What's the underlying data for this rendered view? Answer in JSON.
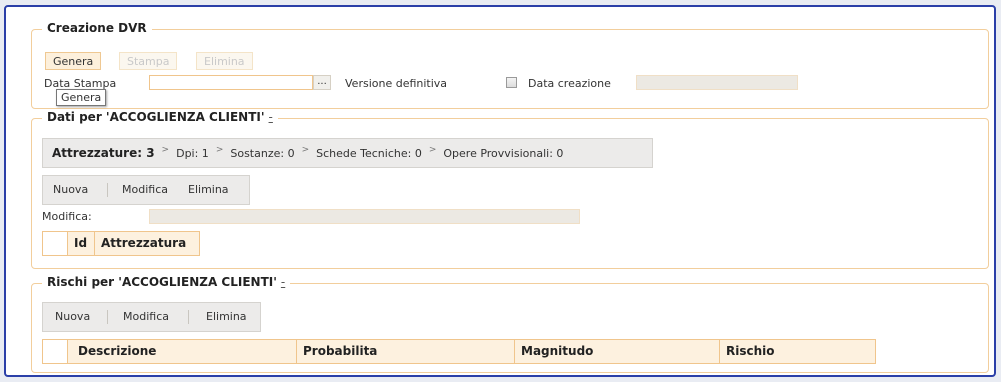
{
  "creazione": {
    "legend": "Creazione DVR",
    "buttons": {
      "genera": "Genera",
      "stampa": "Stampa",
      "elimina": "Elimina"
    },
    "data_stampa_label": "Data Stampa",
    "data_stampa_value": "",
    "ellipsis": "...",
    "versione_label": "Versione definitiva",
    "versione_checked": false,
    "data_creazione_label": "Data creazione",
    "data_creazione_value": "",
    "tooltip": "Genera"
  },
  "dati": {
    "legend": "Dati per 'ACCOGLIENZA CLIENTI'",
    "collapse": "-",
    "tabs": [
      {
        "label": "Attrezzature: 3",
        "selected": true
      },
      {
        "label": "Dpi: 1"
      },
      {
        "label": "Sostanze: 0"
      },
      {
        "label": "Schede Tecniche: 0"
      },
      {
        "label": "Opere Provvisionali: 0"
      }
    ],
    "tab_separator": ">",
    "toolbar": {
      "nuova": "Nuova",
      "modifica": "Modifica",
      "elimina": "Elimina"
    },
    "modifica_label": "Modifica:",
    "modifica_value": "",
    "columns": [
      "Id",
      "Attrezzatura"
    ]
  },
  "rischi": {
    "legend": "Rischi per 'ACCOGLIENZA CLIENTI'",
    "collapse": "-",
    "toolbar": {
      "nuova": "Nuova",
      "modifica": "Modifica",
      "elimina": "Elimina"
    },
    "columns": [
      "Descrizione",
      "Probabilita",
      "Magnitudo",
      "Rischio"
    ]
  },
  "colors": {
    "accent_border": "#f0c58c",
    "frame_border": "#2b3fa8",
    "header_bg": "#fdf1df"
  }
}
